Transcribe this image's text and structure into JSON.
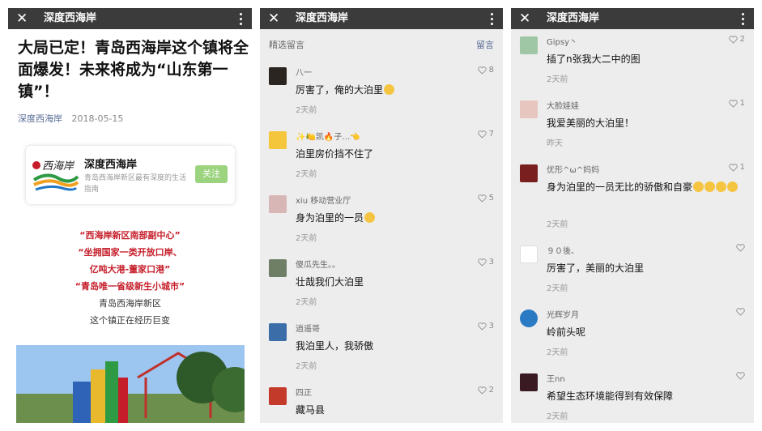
{
  "panels": [
    {
      "header": {
        "title": "深度西海岸"
      },
      "article": {
        "title": "大局已定！青岛西海岸这个镇将全面爆发！未来将成为“山东第一镇”！",
        "account": "深度西海岸",
        "date": "2018-05-15",
        "card": {
          "name": "深度西海岸",
          "logo_text": "西海岸",
          "desc": "青岛西海岸新区最有深度的生活指南",
          "follow_label": "关注"
        },
        "highlight_lines": [
          "“西海岸新区南部副中心”",
          "“坐拥国家一类开放口岸、",
          "亿吨大港-董家口港”",
          "“青岛唯一省级新生小城市”"
        ],
        "plain_lines": [
          "青岛西海岸新区",
          "这个镇正在经历巨变"
        ]
      }
    },
    {
      "header": {
        "title": "深度西海岸"
      },
      "section_title": "精选留言",
      "section_link": "留言",
      "comments": [
        {
          "name": "八一",
          "likes": "8",
          "text": "厉害了，俺的大泊里",
          "time": "2天前"
        },
        {
          "name": "✨🍋凯🔥子…👈",
          "likes": "7",
          "text": "泊里房价挡不住了",
          "time": "2天前"
        },
        {
          "name": "xiu 移动营业厅",
          "likes": "5",
          "text": "身为泊里的一员",
          "time": "2天前"
        },
        {
          "name": "傻瓜先生。。",
          "likes": "3",
          "text": "壮哉我们大泊里",
          "time": "2天前"
        },
        {
          "name": "逍遥哥",
          "likes": "3",
          "text": "我泊里人，我骄傲",
          "time": "2天前"
        },
        {
          "name": "四正",
          "likes": "2",
          "text": "藏马县",
          "time": ""
        }
      ]
    },
    {
      "header": {
        "title": "深度西海岸"
      },
      "comments": [
        {
          "name": "Gipsy丶",
          "likes": "2",
          "text": "插了n张我大二中的图",
          "time": "2天前"
        },
        {
          "name": "大脸娃娃",
          "likes": "1",
          "text": "我爱美丽的大泊里！",
          "time": "昨天"
        },
        {
          "name": "优形^ω^妈妈",
          "likes": "1",
          "text": "身为泊里的一员无比的骄傲和自豪",
          "time": "2天前"
        },
        {
          "name": "９０後、",
          "likes": "",
          "text": "厉害了，美丽的大泊里",
          "time": "2天前"
        },
        {
          "name": "光辉岁月",
          "likes": "",
          "text": "岭前头呢",
          "time": "2天前"
        },
        {
          "name": "王nn",
          "likes": "",
          "text": "希望生态环境能得到有效保障",
          "time": "2天前"
        }
      ]
    }
  ],
  "colors": {
    "topbar": "#3b3b3b",
    "link": "#576b95",
    "highlight": "#c51e2a",
    "follow": "#9bd37f",
    "comment_bg": "#ededed"
  }
}
